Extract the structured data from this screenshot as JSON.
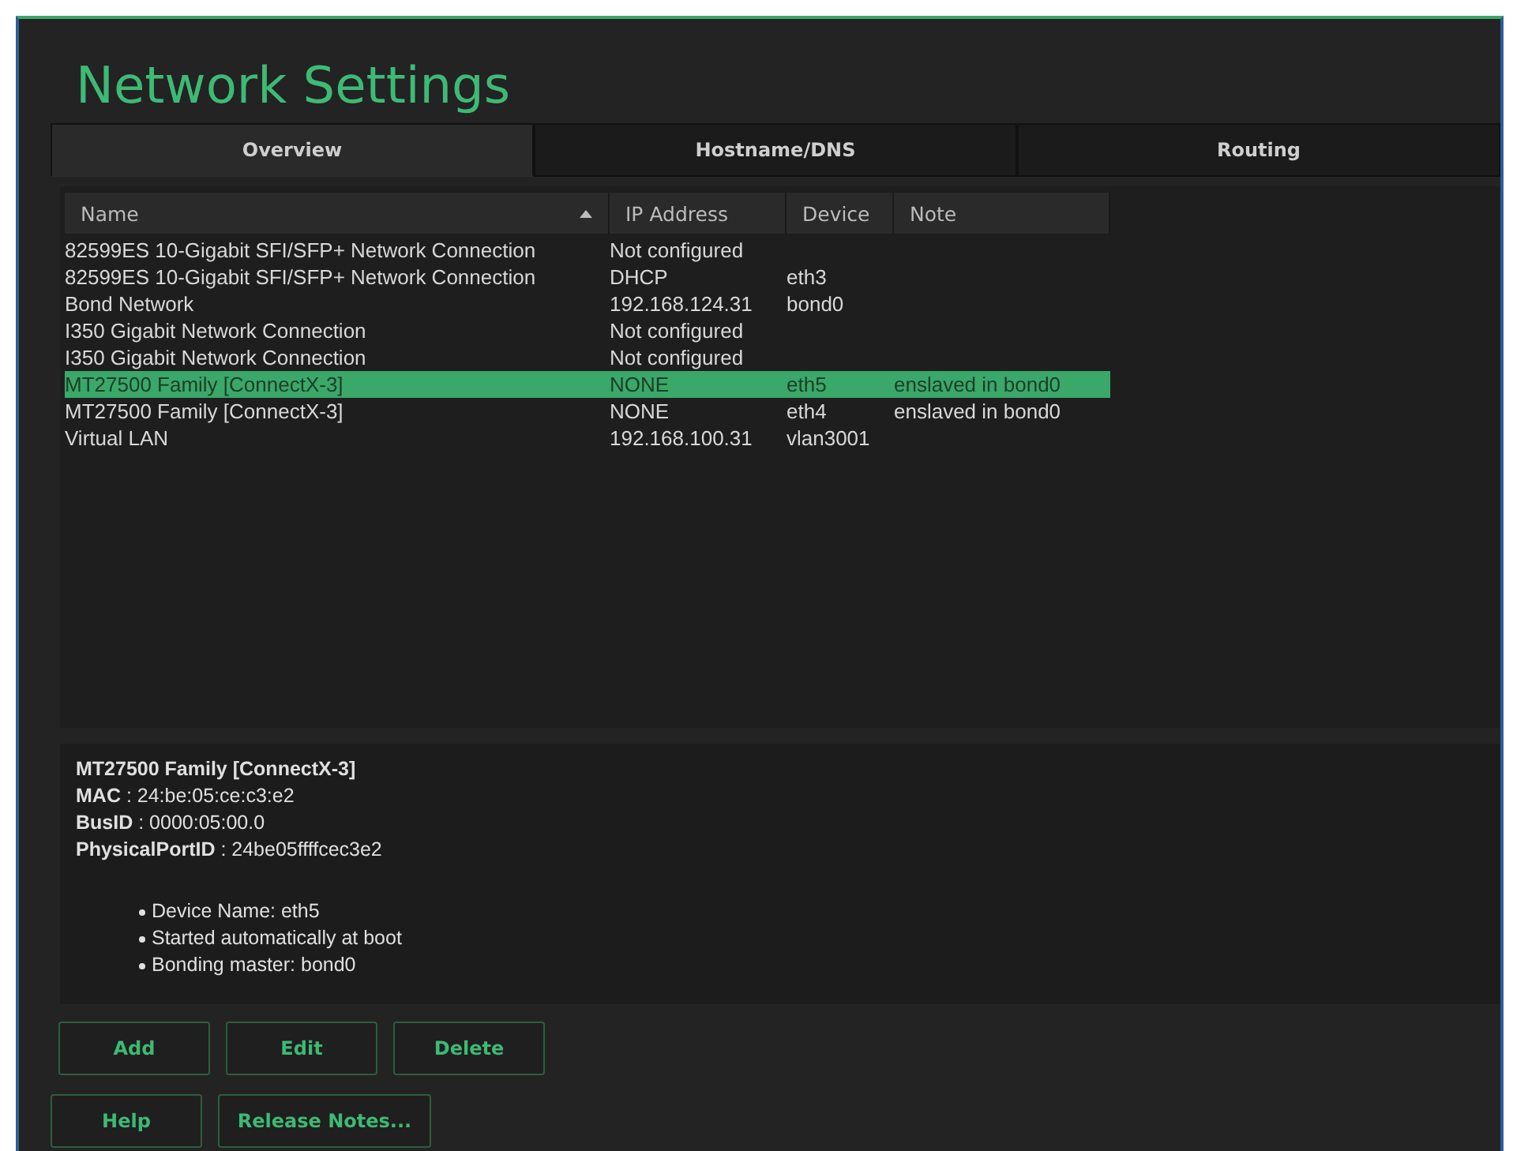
{
  "window": {
    "title": "Network Settings"
  },
  "tabs": [
    {
      "label": "Overview",
      "selected": true
    },
    {
      "label": "Hostname/DNS",
      "selected": false
    },
    {
      "label": "Routing",
      "selected": false
    }
  ],
  "table": {
    "columns": [
      {
        "label": "Name",
        "sorted": true
      },
      {
        "label": "IP Address",
        "sorted": false
      },
      {
        "label": "Device",
        "sorted": false
      },
      {
        "label": "Note",
        "sorted": false
      }
    ],
    "rows": [
      {
        "cells": [
          "82599ES 10-Gigabit SFI/SFP+ Network Connection",
          "Not configured",
          "",
          ""
        ],
        "selected": false
      },
      {
        "cells": [
          "82599ES 10-Gigabit SFI/SFP+ Network Connection",
          "DHCP",
          "eth3",
          ""
        ],
        "selected": false
      },
      {
        "cells": [
          "Bond Network",
          "192.168.124.31",
          "bond0",
          ""
        ],
        "selected": false
      },
      {
        "cells": [
          "I350 Gigabit Network Connection",
          "Not configured",
          "",
          ""
        ],
        "selected": false
      },
      {
        "cells": [
          "I350 Gigabit Network Connection",
          "Not configured",
          "",
          ""
        ],
        "selected": false
      },
      {
        "cells": [
          "MT27500 Family [ConnectX-3]",
          "NONE",
          "eth5",
          "enslaved in bond0"
        ],
        "selected": true
      },
      {
        "cells": [
          "MT27500 Family [ConnectX-3]",
          "NONE",
          "eth4",
          "enslaved in bond0"
        ],
        "selected": false
      },
      {
        "cells": [
          "Virtual LAN",
          "192.168.100.31",
          "vlan3001",
          ""
        ],
        "selected": false
      }
    ]
  },
  "details": {
    "title": "MT27500 Family [ConnectX-3]",
    "fields": [
      "**MAC** : 24:be:05:ce:c3:e2",
      "**BusID** : 0000:05:00.0",
      "**PhysicalPortID** : 24be05ffffcec3e2"
    ],
    "bullets": [
      "Device Name: eth5",
      "Started automatically at boot",
      "Bonding master: bond0"
    ]
  },
  "buttons": [
    "Add",
    "Edit",
    "Delete"
  ],
  "bottom_buttons": [
    "Help",
    "Release Notes..."
  ]
}
